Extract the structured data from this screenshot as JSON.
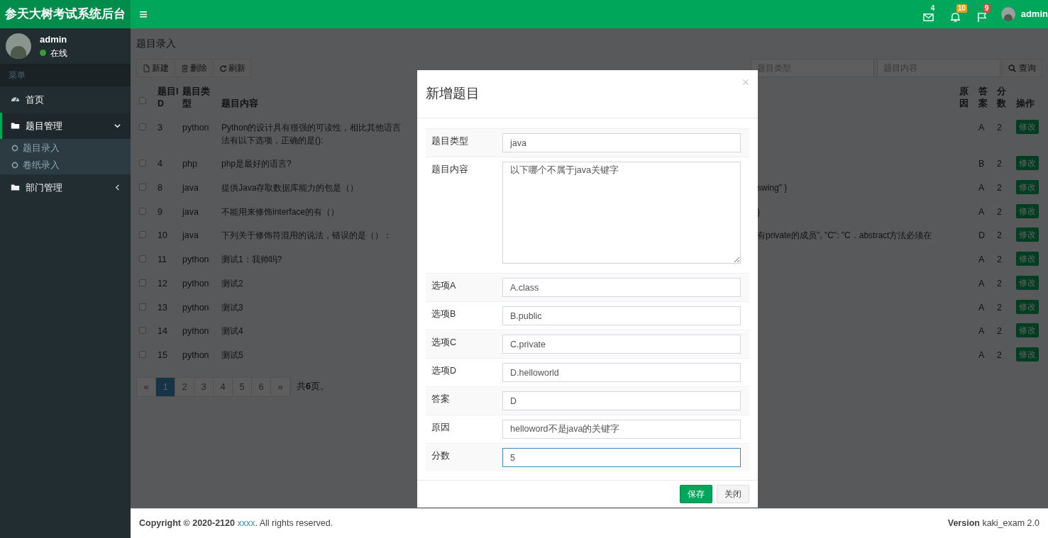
{
  "header": {
    "title": "参天大树考试系统后台",
    "menu_icon": "≡",
    "notifications": [
      {
        "kind": "mail",
        "count": "4",
        "color": "#00a65a"
      },
      {
        "kind": "bell",
        "count": "10",
        "color": "#f39c12"
      },
      {
        "kind": "flag",
        "count": "9",
        "color": "#dd4b39"
      }
    ],
    "user": "admin"
  },
  "sidebar": {
    "user": {
      "name": "admin",
      "status": "在线"
    },
    "menu_header": "菜单",
    "items": [
      {
        "kind": "link",
        "label": "首页",
        "selected": false
      },
      {
        "kind": "tree",
        "label": "题目管理",
        "selected": true,
        "expanded": true,
        "children": [
          {
            "label": "题目录入",
            "selected": false
          },
          {
            "label": "卷纸录入",
            "selected": false
          }
        ]
      },
      {
        "kind": "tree",
        "label": "部门管理",
        "selected": false,
        "expanded": false
      }
    ]
  },
  "page_title": "题目录入",
  "toolbar": [
    {
      "kind": "file",
      "label": "新建"
    },
    {
      "kind": "trash",
      "label": "删除"
    },
    {
      "kind": "refresh",
      "label": "刷新"
    }
  ],
  "search": {
    "fields": [
      {
        "placeholder": "题目类型"
      },
      {
        "placeholder": "题目内容"
      }
    ],
    "button": "查询"
  },
  "table": {
    "select_all_checked": false,
    "columns": [
      "题目ID",
      "题目类型",
      "题目内容",
      "原因",
      "答案",
      "分数",
      "操作"
    ],
    "rows": [
      {
        "checked": false,
        "id": "3",
        "type": "python",
        "content": [
          "Python的设计具有很强的可读性，相比其他语言",
          "法有以下选项，正确的是():"
        ],
        "answer": "A",
        "score": "2",
        "action": "修改"
      },
      {
        "checked": false,
        "id": "4",
        "type": "php",
        "content": [
          "php是最好的语言?"
        ],
        "answer": "B",
        "score": "2",
        "action": "修改"
      },
      {
        "checked": false,
        "id": "8",
        "type": "java",
        "content": [
          "提供Java存取数据库能力的包是（）"
        ],
        "content_tail": "swing\" }",
        "answer": "A",
        "score": "2",
        "action": "修改"
      },
      {
        "checked": false,
        "id": "9",
        "type": "java",
        "content": [
          "不能用来修饰interface的有（）"
        ],
        "content_tail": "}",
        "answer": "A",
        "score": "2",
        "action": "修改"
      },
      {
        "checked": false,
        "id": "10",
        "type": "java",
        "content": [
          "下列关于修饰符混用的说法，错误的是（）："
        ],
        "content_tail": "有private的成员\", \"C\": \"C．abstract方法必须在",
        "answer": "D",
        "score": "2",
        "action": "修改"
      },
      {
        "checked": false,
        "id": "11",
        "type": "python",
        "content": [
          "测试1：我帅吗?"
        ],
        "answer": "A",
        "score": "2",
        "action": "修改"
      },
      {
        "checked": false,
        "id": "12",
        "type": "python",
        "content": [
          "测试2"
        ],
        "answer": "A",
        "score": "2",
        "action": "修改"
      },
      {
        "checked": false,
        "id": "13",
        "type": "python",
        "content": [
          "测试3"
        ],
        "answer": "A",
        "score": "2",
        "action": "修改"
      },
      {
        "checked": false,
        "id": "14",
        "type": "python",
        "content": [
          "测试4"
        ],
        "answer": "A",
        "score": "2",
        "action": "修改"
      },
      {
        "checked": false,
        "id": "15",
        "type": "python",
        "content": [
          "测试5"
        ],
        "answer": "A",
        "score": "2",
        "action": "修改"
      }
    ]
  },
  "pagination": {
    "prev": "«",
    "pages": [
      {
        "label": "1",
        "selected": true
      },
      {
        "label": "2",
        "selected": false
      },
      {
        "label": "3",
        "selected": false
      },
      {
        "label": "4",
        "selected": false
      },
      {
        "label": "5",
        "selected": false
      },
      {
        "label": "6",
        "selected": false
      }
    ],
    "next": "»",
    "total": "共**6**页。"
  },
  "modal": {
    "title": "新增题目",
    "close": "×",
    "fields": [
      {
        "kind": "input",
        "label": "题目类型",
        "value": "java",
        "focused": false
      },
      {
        "kind": "textarea",
        "label": "题目内容",
        "value": "以下哪个不属于java关键字",
        "focused": false
      },
      {
        "kind": "input",
        "label": "选项A",
        "value": "A.class",
        "focused": false
      },
      {
        "kind": "input",
        "label": "选项B",
        "value": "B.public",
        "focused": false
      },
      {
        "kind": "input",
        "label": "选项C",
        "value": "C.private",
        "focused": false
      },
      {
        "kind": "input",
        "label": "选项D",
        "value": "D.helloworld",
        "focused": false
      },
      {
        "kind": "input",
        "label": "答案",
        "value": "D",
        "focused": false
      },
      {
        "kind": "input",
        "label": "原因",
        "value": "helloword不是java的关键字",
        "focused": false
      },
      {
        "kind": "input",
        "label": "分数",
        "value": "5",
        "focused": true
      }
    ],
    "buttons": [
      {
        "kind": "primary",
        "label": "保存"
      },
      {
        "kind": "default",
        "label": "关闭"
      }
    ]
  },
  "footer": {
    "copyright": "**Copyright © 2020-2120**",
    "link": "xxxx",
    "suffix": ". All rights reserved.",
    "version": "**Version** kaki_exam 2.0"
  }
}
